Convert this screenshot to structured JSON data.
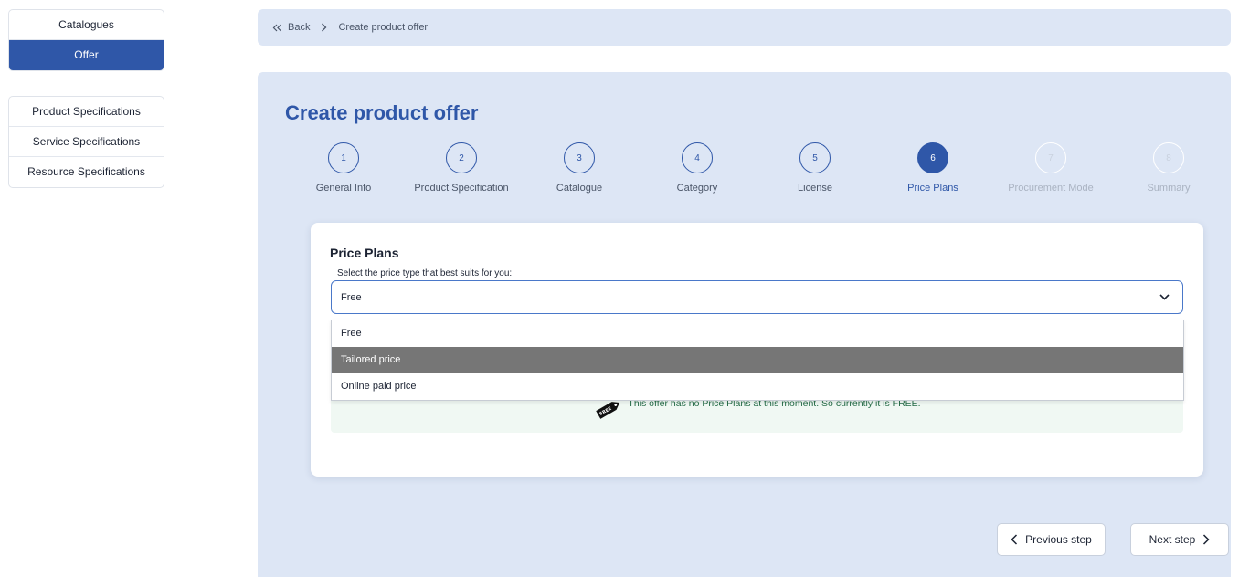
{
  "sidebar": {
    "group1": [
      {
        "label": "Catalogues",
        "active": false
      },
      {
        "label": "Offer",
        "active": true
      }
    ],
    "group2": [
      {
        "label": "Product Specifications"
      },
      {
        "label": "Service Specifications"
      },
      {
        "label": "Resource Specifications"
      }
    ]
  },
  "breadcrumb": {
    "back_label": "Back",
    "current": "Create product offer"
  },
  "page": {
    "title": "Create product offer"
  },
  "steps": [
    {
      "number": "1",
      "label": "General Info",
      "state": "done"
    },
    {
      "number": "2",
      "label": "Product Specification",
      "state": "done"
    },
    {
      "number": "3",
      "label": "Catalogue",
      "state": "done"
    },
    {
      "number": "4",
      "label": "Category",
      "state": "done"
    },
    {
      "number": "5",
      "label": "License",
      "state": "done"
    },
    {
      "number": "6",
      "label": "Price Plans",
      "state": "current"
    },
    {
      "number": "7",
      "label": "Procurement Mode",
      "state": "future"
    },
    {
      "number": "8",
      "label": "Summary",
      "state": "future"
    }
  ],
  "price_plans": {
    "title": "Price Plans",
    "select_label": "Select the price type that best suits for you:",
    "selected": "Free",
    "options": [
      "Free",
      "Tailored price",
      "Online paid price"
    ],
    "hovered_option": "Tailored price",
    "notice_badge": "FREE",
    "notice_text": "This offer has no Price Plans at this moment. So currently it is FREE."
  },
  "nav": {
    "previous_label": "Previous step",
    "next_label": "Next step"
  },
  "colors": {
    "primary": "#2f57a8",
    "panel_bg": "#dde6f5",
    "notice_bg": "#f0f8f3",
    "notice_text": "#236b46",
    "hover_option": "#767676"
  }
}
